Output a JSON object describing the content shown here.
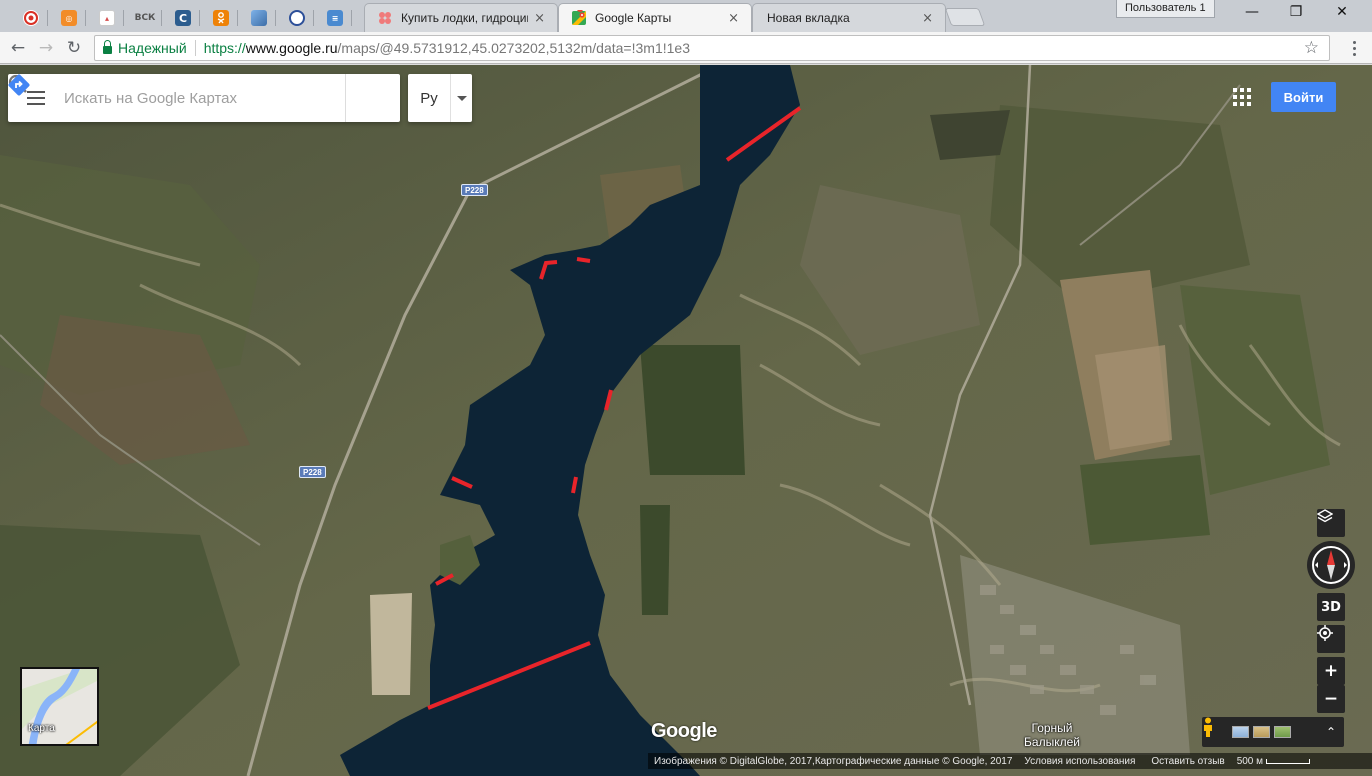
{
  "browser": {
    "pinned_tabs": [
      {
        "icon": "opera-icon",
        "label": "",
        "color": "#d93025"
      },
      {
        "icon": "ok-orange-icon",
        "label": "",
        "color": "#f28c28"
      },
      {
        "icon": "bookmark-icon",
        "label": "",
        "color": "#d54d4d"
      },
      {
        "icon": "vsk-icon",
        "label": "ВСК",
        "color": "#8a8a8a"
      },
      {
        "icon": "blue-c-icon",
        "label": "",
        "color": "#2c5d8f"
      },
      {
        "icon": "odnoklassniki-icon",
        "label": "",
        "color": "#ee8208"
      },
      {
        "icon": "picture-icon",
        "label": "",
        "color": "#3d6ea8"
      },
      {
        "icon": "globe-icon",
        "label": "",
        "color": "#2c4f99"
      },
      {
        "icon": "doc-icon",
        "label": "",
        "color": "#4a8ad0"
      }
    ],
    "tabs": [
      {
        "title": "Купить лодки, гидроцик",
        "active": false
      },
      {
        "title": "Google Карты",
        "active": true
      },
      {
        "title": "Новая вкладка",
        "active": false
      }
    ],
    "close_glyph": "×",
    "profile": "Пользователь 1",
    "window_controls": {
      "minimize": "—",
      "restore": "❐",
      "close": "✕"
    },
    "nav": {
      "back": "←",
      "forward": "→",
      "reload": "↻"
    },
    "secure_label": "Надежный",
    "url": {
      "protocol": "https://",
      "host": "www.google.ru",
      "path": "/maps/@49.5731912,45.0273202,5132m/data=!3m1!1e3"
    },
    "bookmark_glyph": "☆"
  },
  "maps": {
    "search_placeholder": "Искать на Google Картах",
    "language": "Ру",
    "signin_label": "Войти",
    "road_labels": [
      "P228",
      "P228"
    ],
    "town_label": "Горный Балыклей",
    "minimap_label": "Карта",
    "logo": "Google",
    "controls": {
      "three_d": "3D",
      "zoom_in": "+",
      "zoom_out": "−",
      "expand": "⌃"
    },
    "footer": {
      "imagery": "Изображения © DigitalGlobe, 2017,Картографические данные © Google, 2017",
      "terms": "Условия использования",
      "feedback": "Оставить отзыв",
      "scale": "500 м"
    }
  },
  "colors": {
    "accent": "#4285f4",
    "secure_green": "#0b8043",
    "marker_red": "#e8242a",
    "water": "#0d2436",
    "terrain": "#5c6141"
  }
}
